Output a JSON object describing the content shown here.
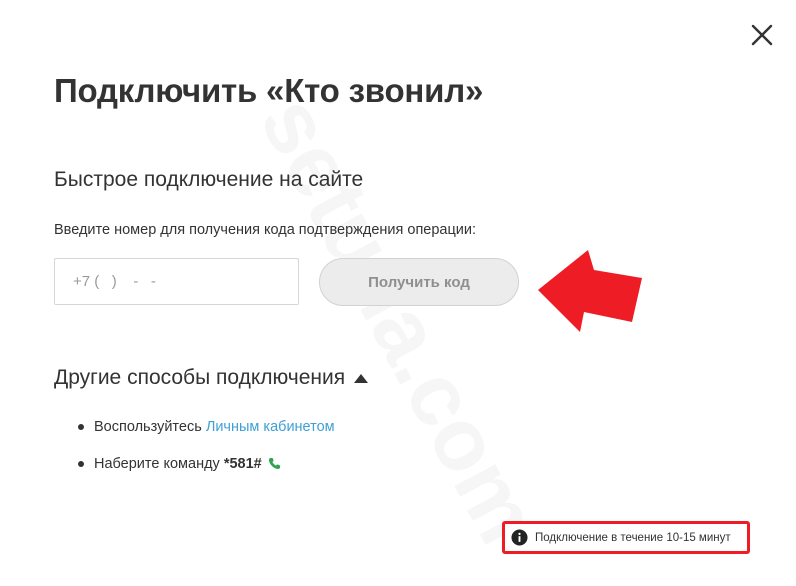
{
  "dialog": {
    "title": "Подключить «Кто звонил»",
    "close_label": "×"
  },
  "quick": {
    "heading": "Быстрое подключение на сайте",
    "hint": "Введите номер для получения кода подтверждения операции:",
    "phone_placeholder": "+7 (   )    -   -",
    "phone_value": "",
    "button_label": "Получить код",
    "button_state": "disabled"
  },
  "other": {
    "heading": "Другие способы подключения",
    "expanded": true,
    "items": [
      {
        "prefix": "Воспользуйтесь ",
        "link": "Личным кабинетом"
      },
      {
        "prefix": "Наберите команду ",
        "command": "*581#",
        "icon": "phone-icon"
      }
    ]
  },
  "notice": {
    "icon": "info-icon",
    "text": "Подключение в течение 10-15 минут"
  },
  "watermark": "setuna.com",
  "colors": {
    "accent_link": "#3fa0d6",
    "highlight_red": "#ee1c25",
    "phone_green": "#2ea44f",
    "text": "#333333"
  }
}
